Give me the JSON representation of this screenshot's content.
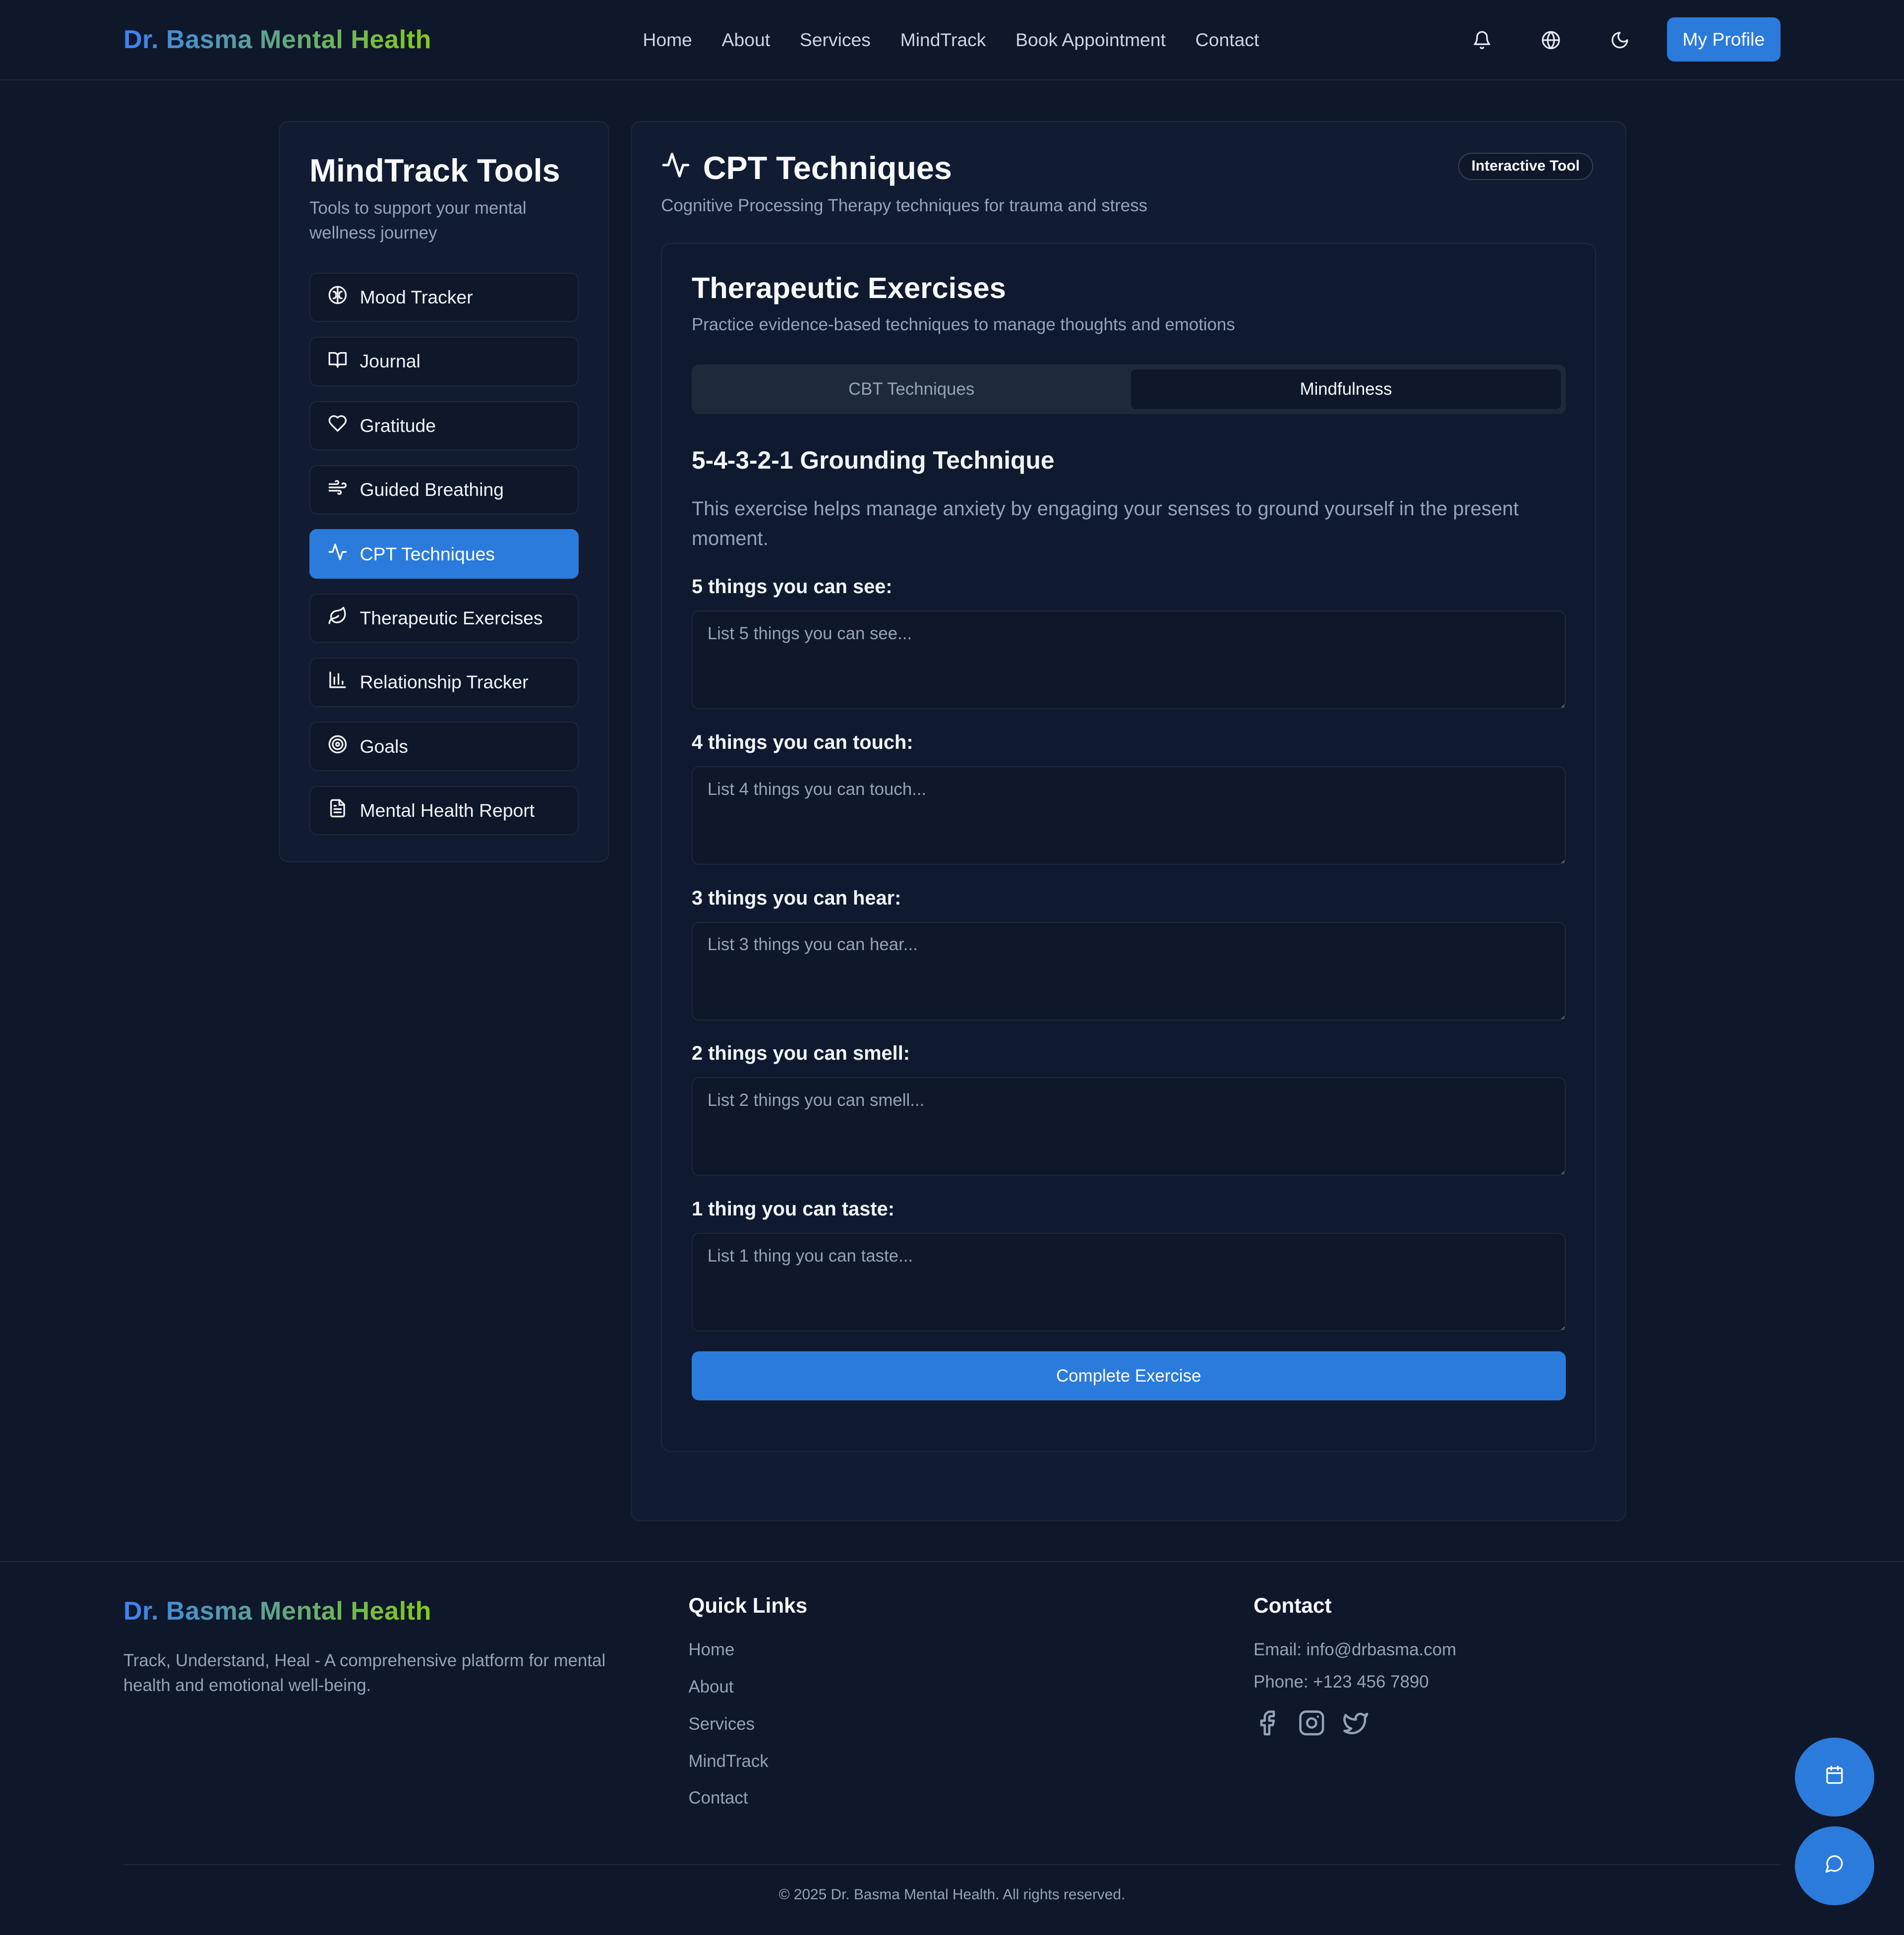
{
  "header": {
    "brand": "Dr. Basma Mental Health",
    "nav": [
      "Home",
      "About",
      "Services",
      "MindTrack",
      "Book Appointment",
      "Contact"
    ],
    "icons": [
      "bell-icon",
      "globe-icon",
      "moon-icon"
    ],
    "profile_label": "My Profile"
  },
  "sidebar": {
    "title": "MindTrack Tools",
    "subtitle": "Tools to support your mental wellness journey",
    "items": [
      {
        "label": "Mood Tracker",
        "icon": "brain-icon"
      },
      {
        "label": "Journal",
        "icon": "book-open-icon"
      },
      {
        "label": "Gratitude",
        "icon": "heart-icon"
      },
      {
        "label": "Guided Breathing",
        "icon": "wind-icon"
      },
      {
        "label": "CPT Techniques",
        "icon": "activity-icon"
      },
      {
        "label": "Therapeutic Exercises",
        "icon": "leaf-icon"
      },
      {
        "label": "Relationship Tracker",
        "icon": "bar-chart-icon"
      },
      {
        "label": "Goals",
        "icon": "target-icon"
      },
      {
        "label": "Mental Health Report",
        "icon": "file-text-icon"
      }
    ],
    "active_index": 4
  },
  "main": {
    "title": "CPT Techniques",
    "badge": "Interactive Tool",
    "description": "Cognitive Processing Therapy techniques for trauma and stress",
    "card": {
      "title": "Therapeutic Exercises",
      "subtitle": "Practice evidence-based techniques to manage thoughts and emotions",
      "tabs": [
        "CBT Techniques",
        "Mindfulness"
      ],
      "active_tab": 1,
      "exercise_title": "5-4-3-2-1 Grounding Technique",
      "exercise_intro": "This exercise helps manage anxiety by engaging your senses to ground yourself in the present moment.",
      "fields": [
        {
          "label": "5 things you can see:",
          "placeholder": "List 5 things you can see...",
          "value": ""
        },
        {
          "label": "4 things you can touch:",
          "placeholder": "List 4 things you can touch...",
          "value": ""
        },
        {
          "label": "3 things you can hear:",
          "placeholder": "List 3 things you can hear...",
          "value": ""
        },
        {
          "label": "2 things you can smell:",
          "placeholder": "List 2 things you can smell...",
          "value": ""
        },
        {
          "label": "1 thing you can taste:",
          "placeholder": "List 1 thing you can taste...",
          "value": ""
        }
      ],
      "complete_label": "Complete Exercise"
    }
  },
  "footer": {
    "brand": "Dr. Basma Mental Health",
    "tagline": "Track, Understand, Heal - A comprehensive platform for mental health and emotional well-being.",
    "quick_links_title": "Quick Links",
    "quick_links": [
      "Home",
      "About",
      "Services",
      "MindTrack",
      "Contact"
    ],
    "contact_title": "Contact",
    "email": "Email: info@drbasma.com",
    "phone": "Phone: +123 456 7890",
    "socials": [
      "facebook-icon",
      "instagram-icon",
      "twitter-icon"
    ],
    "copyright": "© 2025 Dr. Basma Mental Health. All rights reserved."
  },
  "floating": [
    "calendar-icon",
    "chat-icon"
  ],
  "colors": {
    "background": "#0f172a",
    "panel": "#111c33",
    "accent": "#2b7bdc",
    "brand_gradient_start": "#3b82f6",
    "brand_gradient_end": "#84cc16"
  }
}
